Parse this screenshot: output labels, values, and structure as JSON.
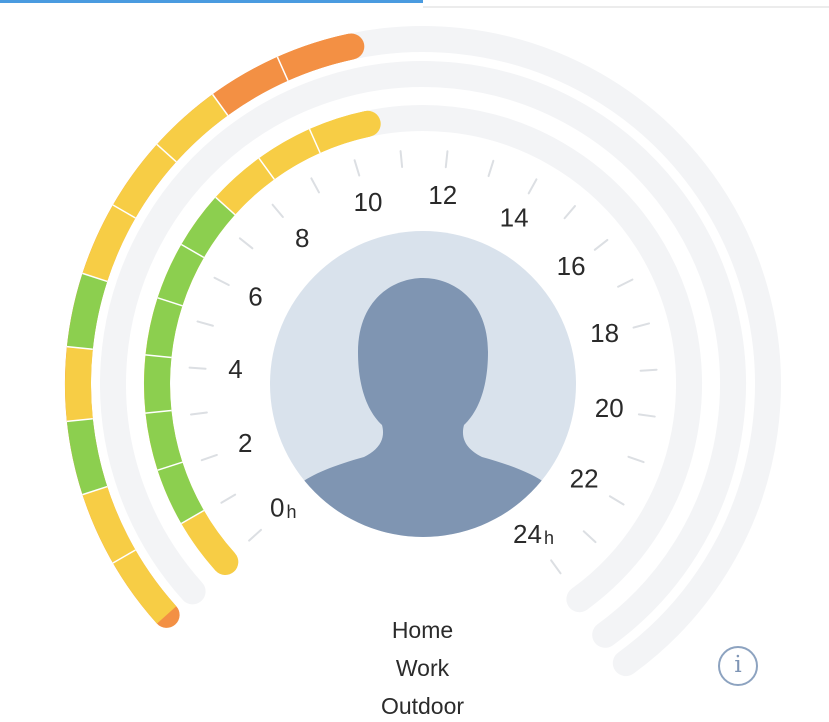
{
  "colors": {
    "tab_indicator": "#4a9be0",
    "track": "#f3f4f6",
    "green": "#8ccf4f",
    "yellow": "#f7cd45",
    "orange": "#f39044",
    "avatar_bg": "#d9e2ec",
    "avatar_silhouette": "#7f95b2"
  },
  "dial": {
    "hour_labels": [
      "0",
      "2",
      "4",
      "6",
      "8",
      "10",
      "12",
      "14",
      "16",
      "18",
      "20",
      "22",
      "24"
    ],
    "hour_unit": "h"
  },
  "exposure": {
    "outer_ring_colors": [
      "yellow",
      "yellow",
      "green",
      "yellow",
      "green",
      "yellow",
      "yellow",
      "yellow",
      "orange",
      "orange"
    ],
    "inner_ring_colors": [
      "yellow",
      "green",
      "green",
      "green",
      "green",
      "green",
      "green",
      "yellow",
      "yellow",
      "yellow"
    ]
  },
  "legend": {
    "home": "Home",
    "work": "Work",
    "outdoor": "Outdoor"
  },
  "icons": {
    "avatar": "person-silhouette-icon",
    "info": "info-icon"
  },
  "info_glyph": "i"
}
